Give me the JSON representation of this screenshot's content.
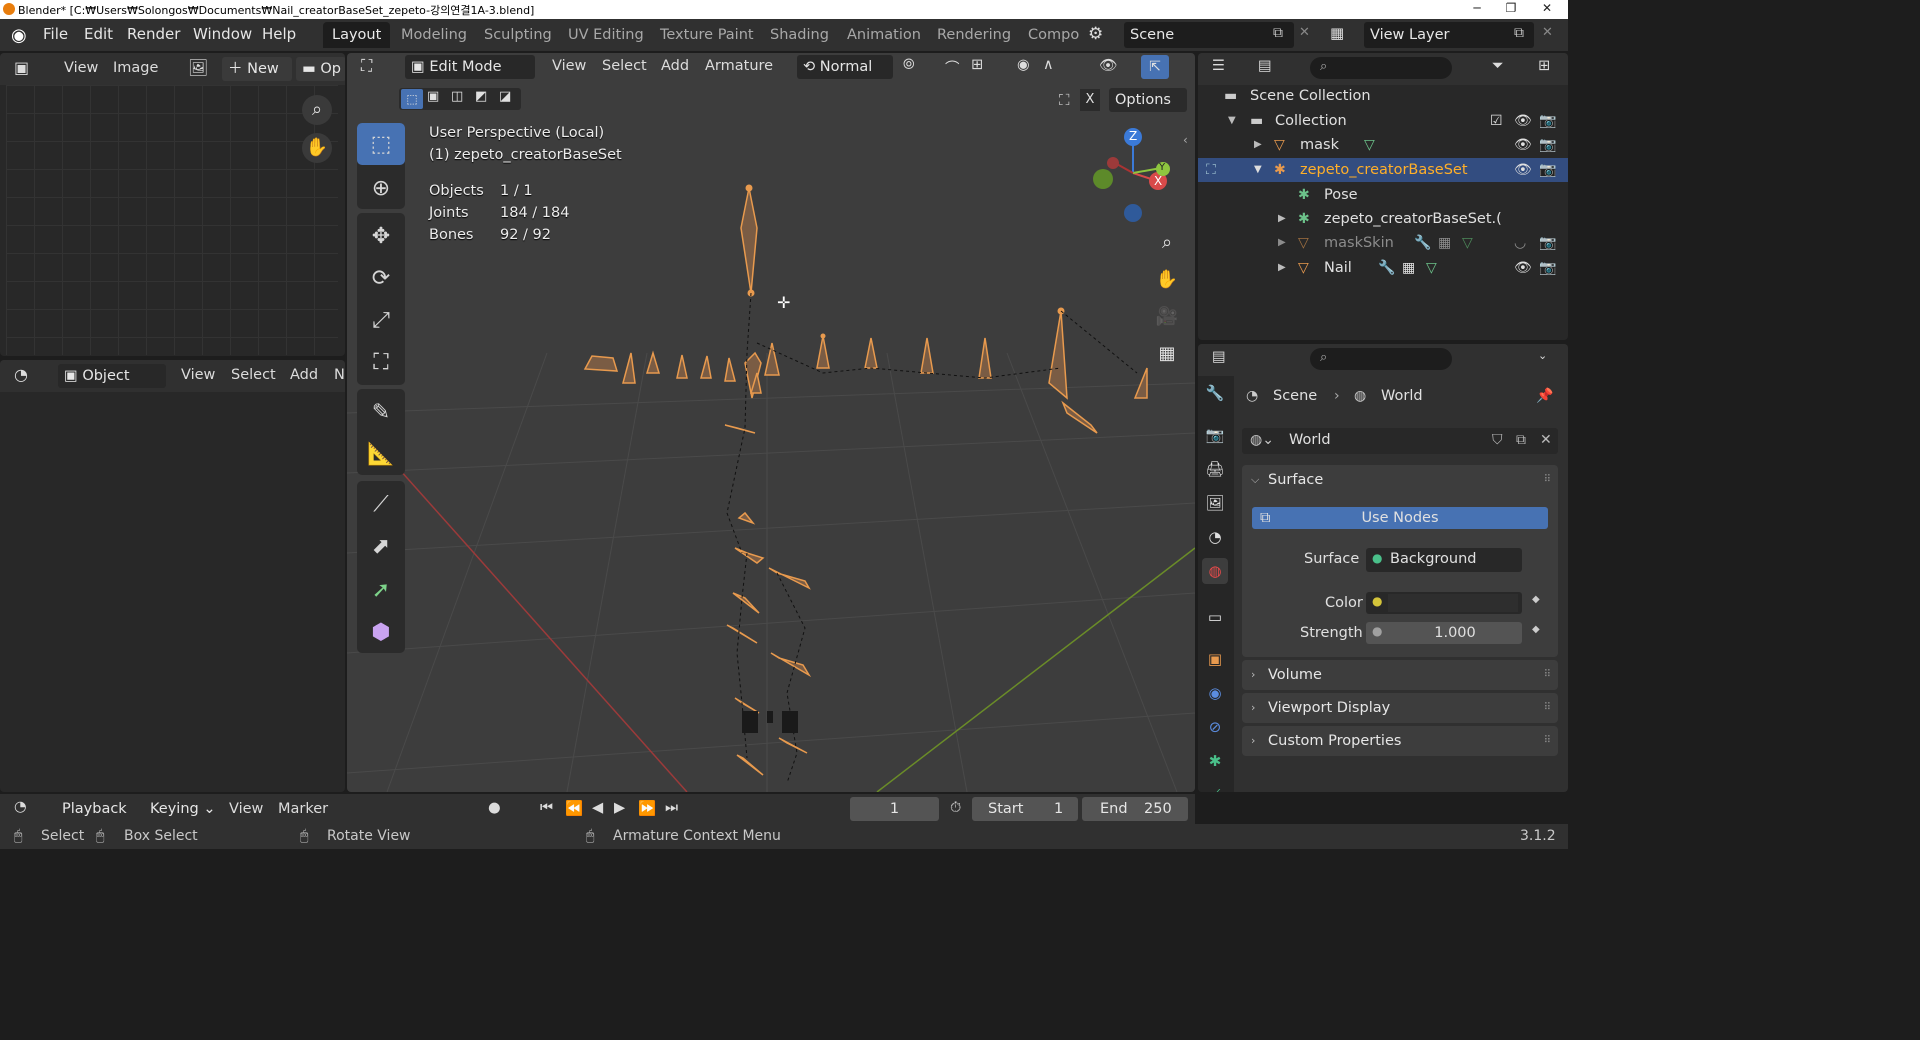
{
  "window": {
    "title": "Blender* [C:₩Users₩Solongos₩Documents₩Nail_creatorBaseSet_zepeto-강의연결1A-3.blend]",
    "min": "─",
    "max": "❐",
    "close": "✕"
  },
  "menu": [
    "File",
    "Edit",
    "Render",
    "Window",
    "Help"
  ],
  "workspaces": [
    "Layout",
    "Modeling",
    "Sculpting",
    "UV Editing",
    "Texture Paint",
    "Shading",
    "Animation",
    "Rendering",
    "Compo"
  ],
  "scene_name": "Scene",
  "view_layer": "View Layer",
  "image_editor": {
    "view": "View",
    "image": "Image",
    "new": "New",
    "open": "Op"
  },
  "left_lower": {
    "mode": "Object",
    "view": "View",
    "select": "Select",
    "add": "Add",
    "more": "N"
  },
  "viewport": {
    "mode": "Edit Mode",
    "menus": [
      "View",
      "Select",
      "Add",
      "Armature"
    ],
    "orientation": "Normal",
    "options": "Options",
    "info_line1": "User Perspective (Local)",
    "info_line2": "(1) zepeto_creatorBaseSet",
    "stats": [
      {
        "label": "Objects",
        "value": "1 / 1"
      },
      {
        "label": "Joints",
        "value": "184 / 184"
      },
      {
        "label": "Bones",
        "value": "92 / 92"
      }
    ],
    "gizmo": {
      "z": "Z",
      "x": "X",
      "y": "Y"
    }
  },
  "outliner": {
    "rows": [
      {
        "label": "Scene Collection"
      },
      {
        "label": "Collection"
      },
      {
        "label": "mask"
      },
      {
        "label": "zepeto_creatorBaseSet"
      },
      {
        "label": "Pose"
      },
      {
        "label": "zepeto_creatorBaseSet.("
      },
      {
        "label": "maskSkin"
      },
      {
        "label": "Nail"
      }
    ]
  },
  "properties": {
    "breadcrumb_scene": "Scene",
    "breadcrumb_world": "World",
    "world_name": "World",
    "surface_panel": "Surface",
    "use_nodes": "Use Nodes",
    "surface_label": "Surface",
    "surface_value": "Background",
    "color_label": "Color",
    "strength_label": "Strength",
    "strength_value": "1.000",
    "panels": [
      "Volume",
      "Viewport Display",
      "Custom Properties"
    ]
  },
  "timeline": {
    "playback": "Playback",
    "keying": "Keying",
    "view": "View",
    "marker": "Marker",
    "frame": "1",
    "start_label": "Start",
    "start": "1",
    "end_label": "End",
    "end": "250"
  },
  "status": {
    "select": "Select",
    "box_select": "Box Select",
    "rotate": "Rotate View",
    "context": "Armature Context Menu",
    "version": "3.1.2"
  },
  "colors": {
    "accent_blue": "#4772b3",
    "bone_orange": "#e89a4e",
    "selected_row": "#334d80",
    "axis_red": "#9c3a3a",
    "axis_green": "#6a8c28"
  }
}
